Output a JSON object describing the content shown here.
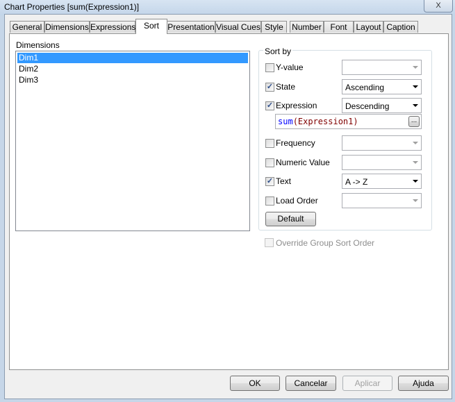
{
  "window": {
    "title": "Chart Properties [sum(Expression1)]",
    "close_label": "X"
  },
  "tabs": [
    {
      "label": "General"
    },
    {
      "label": "Dimensions"
    },
    {
      "label": "Expressions"
    },
    {
      "label": "Sort",
      "active": true
    },
    {
      "label": "Presentation"
    },
    {
      "label": "Visual Cues"
    },
    {
      "label": "Style"
    },
    {
      "label": "Number"
    },
    {
      "label": "Font"
    },
    {
      "label": "Layout"
    },
    {
      "label": "Caption"
    }
  ],
  "dimensions": {
    "label": "Dimensions",
    "items": [
      {
        "label": "Dim1",
        "selected": true
      },
      {
        "label": "Dim2"
      },
      {
        "label": "Dim3"
      }
    ]
  },
  "sort_by": {
    "label": "Sort by",
    "options": [
      {
        "label": "Y-value",
        "checked": false,
        "dropdown": "",
        "enabled": false
      },
      {
        "label": "State",
        "checked": true,
        "dropdown": "Ascending",
        "enabled": true
      },
      {
        "label": "Expression",
        "checked": true,
        "dropdown": "Descending",
        "enabled": true
      },
      {
        "label": "Frequency",
        "checked": false,
        "dropdown": "",
        "enabled": false
      },
      {
        "label": "Numeric Value",
        "checked": false,
        "dropdown": "",
        "enabled": false
      },
      {
        "label": "Text",
        "checked": true,
        "dropdown": "A -> Z",
        "enabled": true
      },
      {
        "label": "Load Order",
        "checked": false,
        "dropdown": "",
        "enabled": false
      }
    ],
    "expression": {
      "func": "sum",
      "arg": "(Expression1)",
      "browse_label": "..."
    },
    "default_label": "Default"
  },
  "override": {
    "label": "Override Group Sort Order",
    "checked": false,
    "enabled": false
  },
  "buttons": {
    "ok": "OK",
    "cancel": "Cancelar",
    "apply": "Aplicar",
    "help": "Ajuda"
  },
  "colors": {
    "selection": "#3399ff",
    "expr_func": "#0000ff",
    "expr_arg": "#800000"
  }
}
